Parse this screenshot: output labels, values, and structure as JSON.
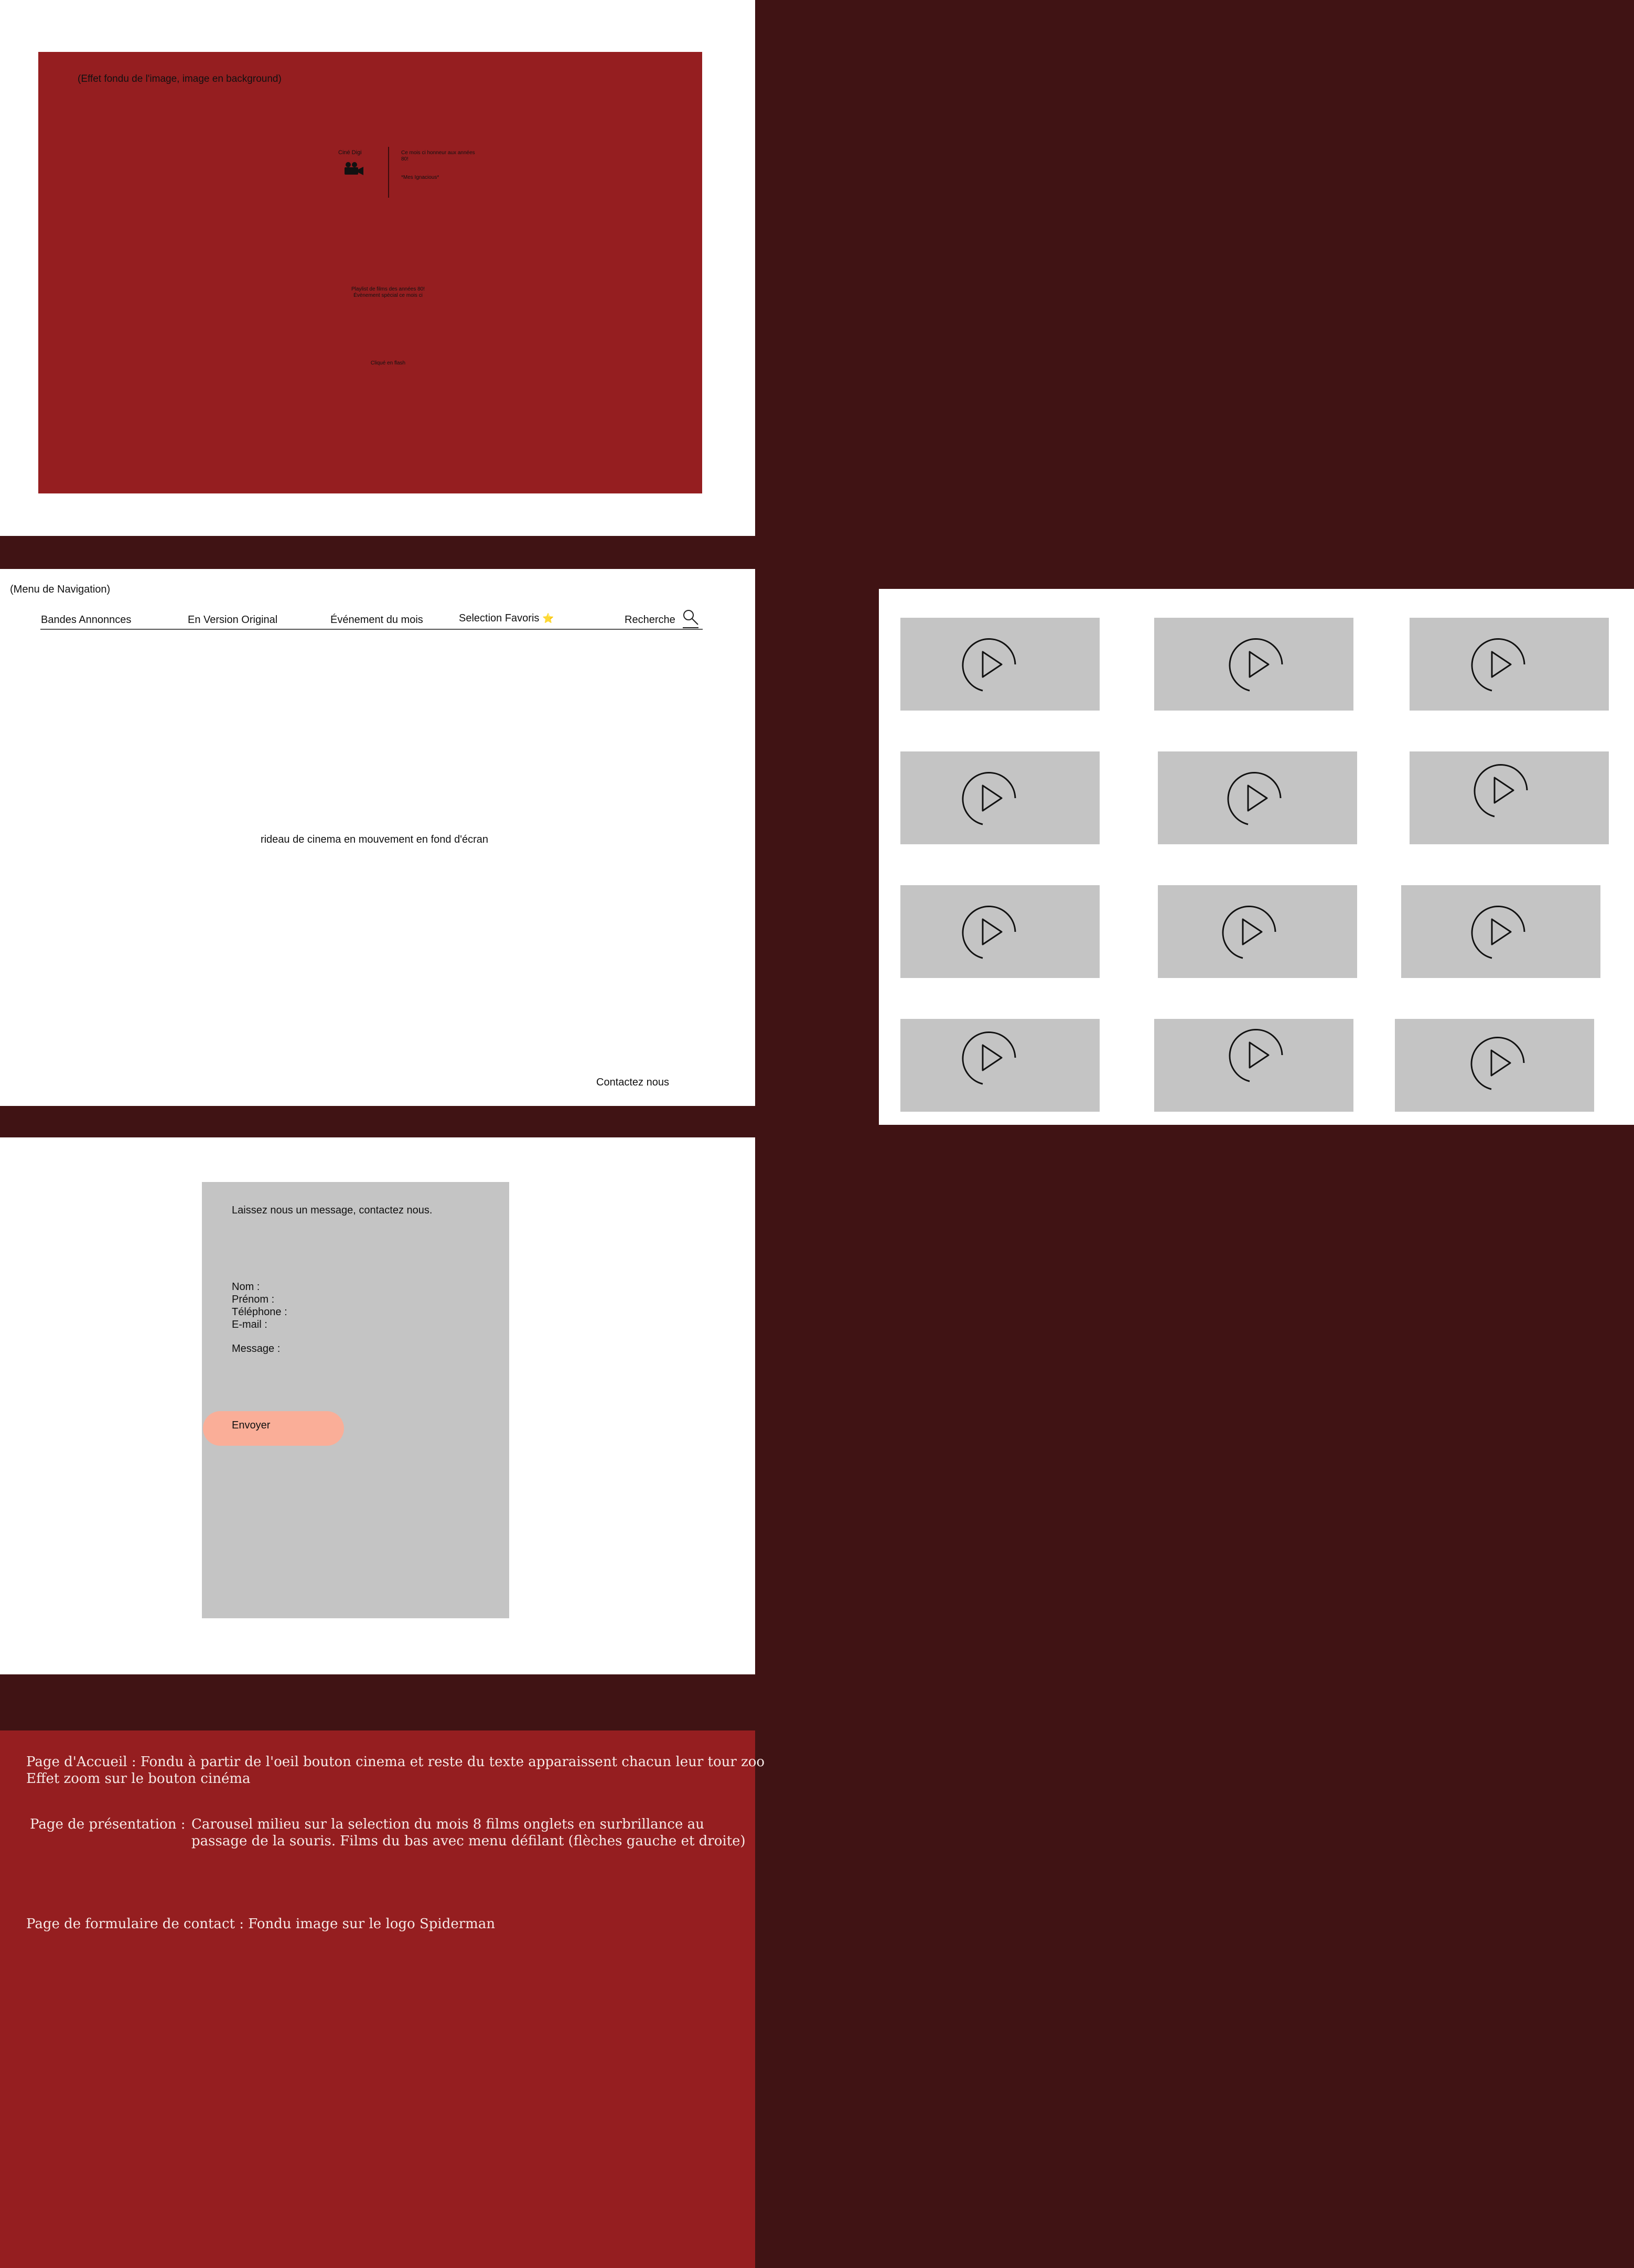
{
  "home": {
    "note": "(Effet fondu de l'image, image en background)",
    "brand": "Ciné Digi",
    "camera_icon": "movie-camera-icon",
    "tagline": "Ce mois ci honneur aux années 80!",
    "tagline_sub": "*Mes Ignacious*",
    "event_line1": "Playlist de films des années 80!",
    "event_line2": "Évènement spécial ce mois ci",
    "click_hint": "Cliqué en flash",
    "background_color": "#951e20"
  },
  "navigation": {
    "label": "(Menu de Navigation)",
    "items": [
      {
        "label": "Bandes Annonnces"
      },
      {
        "label": "En Version Original"
      },
      {
        "label": "Événement du mois"
      },
      {
        "label": "Selection Favoris",
        "icon": "star-icon",
        "glyph": "⭐"
      },
      {
        "label": "Recherche",
        "icon": "search-icon"
      }
    ],
    "curtain_text": "rideau de cinema en mouvement en fond d'écran",
    "contact_link": "Contactez nous"
  },
  "contact_form": {
    "title": "Laissez nous un message, contactez nous.",
    "fields": [
      "Nom :",
      "Prénom :",
      "Téléphone :",
      "E-mail :"
    ],
    "message_label": "Message :",
    "submit_label": "Envoyer",
    "submit_color": "#faae98"
  },
  "notes": {
    "home_line1": "Page d'Accueil : Fondu à partir de l'oeil bouton cinema et reste du texte apparaissent chacun leur tour zoo",
    "home_line2": "Effet zoom sur le bouton cinéma",
    "presentation_label": "Page de présentation :",
    "presentation_text": "Carousel milieu sur la selection du mois 8 films onglets en surbrillance au passage de la souris. Films du bas avec menu défilant (flèches gauche et droite)",
    "contact_text": "Page de formulaire de contact : Fondu image sur le logo Spiderman"
  },
  "video_grid": {
    "thumb_icon": "play-circle-icon",
    "count": 12,
    "thumb_color": "#c4c4c4"
  }
}
